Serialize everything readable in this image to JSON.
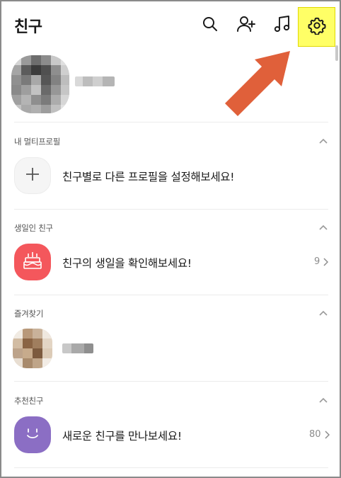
{
  "header": {
    "title": "친구",
    "icons": [
      "search-icon",
      "add-friend-icon",
      "music-icon",
      "settings-icon"
    ],
    "settings_highlight_color": "#ffff66"
  },
  "annotation": {
    "arrow_color": "#e0603a",
    "points_to": "settings-icon"
  },
  "my_profile": {
    "name_redacted": true
  },
  "sections": {
    "multi_profile": {
      "label": "내 멀티프로필",
      "item_text": "친구별로 다른 프로필을 설정해보세요!",
      "icon": "plus-icon"
    },
    "birthday": {
      "label": "생일인 친구",
      "item_text": "친구의 생일을 확인해보세요!",
      "count": "9",
      "icon": "cake-icon",
      "icon_color": "#f4575c"
    },
    "favorites": {
      "label": "즐겨찾기",
      "name_redacted": true
    },
    "recommended": {
      "label": "추천친구",
      "item_text": "새로운 친구를 만나보세요!",
      "count": "80",
      "icon": "smile-icon",
      "icon_color": "#8b6ec4"
    }
  }
}
